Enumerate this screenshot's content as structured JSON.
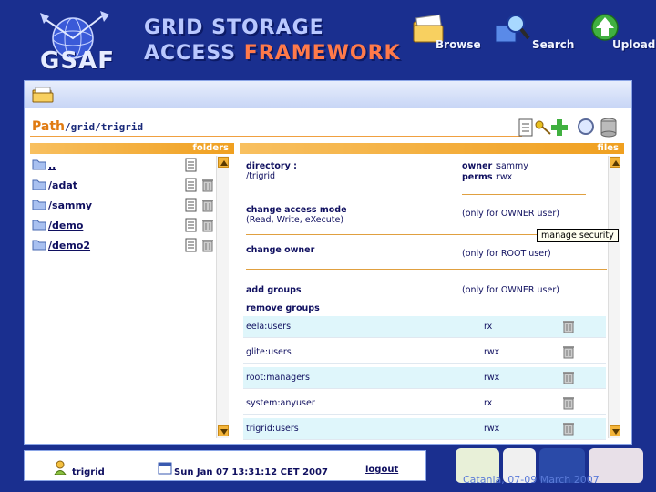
{
  "header": {
    "logo_text": "GSAF",
    "title_line1": "GRID STORAGE",
    "title_line2_a": "ACCESS",
    "title_line2_b": "FRAMEWORK",
    "nav": [
      {
        "label": "Browse",
        "icon": "folder-icon"
      },
      {
        "label": "Search",
        "icon": "magnifier-icon"
      },
      {
        "label": "Upload",
        "icon": "upload-arrow-icon"
      }
    ]
  },
  "path": {
    "label": "Path",
    "value": "/grid/trigrid"
  },
  "folders": {
    "header": "folders",
    "items": [
      {
        "name": ".."
      },
      {
        "name": "/adat"
      },
      {
        "name": "/sammy"
      },
      {
        "name": "/demo"
      },
      {
        "name": "/demo2"
      }
    ]
  },
  "files": {
    "header": "files",
    "tooltip": "manage security",
    "directory_label": "directory :",
    "directory_value": "/trigrid",
    "owner_label": "owner :",
    "owner_value": "sammy",
    "perms_label": "perms :",
    "perms_value": "rwx",
    "access_mode_label": "change access mode",
    "access_mode_sub": "(Read, Write, eXecute)",
    "access_mode_note": "(only for OWNER user)",
    "change_owner_label": "change owner",
    "change_owner_note": "(only for ROOT user)",
    "add_groups_label": "add groups",
    "add_groups_note": "(only for OWNER user)",
    "remove_groups_label": "remove groups",
    "groups": [
      {
        "name": "eela:users",
        "perm": "rx"
      },
      {
        "name": "glite:users",
        "perm": "rwx"
      },
      {
        "name": "root:managers",
        "perm": "rwx"
      },
      {
        "name": "system:anyuser",
        "perm": "rx"
      },
      {
        "name": "trigrid:users",
        "perm": "rwx"
      }
    ]
  },
  "footer": {
    "user": "trigrid",
    "datetime": "Sun Jan 07 13:31:12 CET 2007",
    "logout": "logout",
    "footnote": "Catania, 07-09 March 2007"
  },
  "colors": {
    "background": "#1a2f8f",
    "accent_orange": "#f0a020",
    "row_highlight": "#dff6fb",
    "text_navy": "#101060"
  }
}
